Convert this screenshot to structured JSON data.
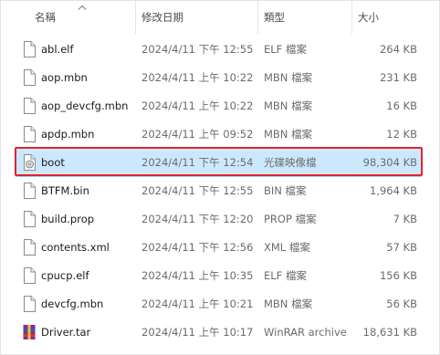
{
  "header": {
    "name": "名稱",
    "date": "修改日期",
    "type": "類型",
    "size": "大小"
  },
  "files": [
    {
      "name": "abl.elf",
      "date": "2024/4/11 下午 12:55",
      "type": "ELF 檔案",
      "size": "264 KB",
      "icon": "file-icon",
      "selected": false
    },
    {
      "name": "aop.mbn",
      "date": "2024/4/11 上午 10:22",
      "type": "MBN 檔案",
      "size": "231 KB",
      "icon": "file-icon",
      "selected": false
    },
    {
      "name": "aop_devcfg.mbn",
      "date": "2024/4/11 上午 10:22",
      "type": "MBN 檔案",
      "size": "16 KB",
      "icon": "file-icon",
      "selected": false
    },
    {
      "name": "apdp.mbn",
      "date": "2024/4/11 上午 09:52",
      "type": "MBN 檔案",
      "size": "12 KB",
      "icon": "file-icon",
      "selected": false
    },
    {
      "name": "boot",
      "date": "2024/4/11 下午 12:54",
      "type": "光碟映像檔",
      "size": "98,304 KB",
      "icon": "disc-image-icon",
      "selected": true
    },
    {
      "name": "BTFM.bin",
      "date": "2024/4/11 下午 12:55",
      "type": "BIN 檔案",
      "size": "1,964 KB",
      "icon": "file-icon",
      "selected": false
    },
    {
      "name": "build.prop",
      "date": "2024/4/11 下午 12:20",
      "type": "PROP 檔案",
      "size": "7 KB",
      "icon": "file-icon",
      "selected": false
    },
    {
      "name": "contents.xml",
      "date": "2024/4/11 下午 12:56",
      "type": "XML 檔案",
      "size": "57 KB",
      "icon": "file-icon",
      "selected": false
    },
    {
      "name": "cpucp.elf",
      "date": "2024/4/11 上午 10:35",
      "type": "ELF 檔案",
      "size": "156 KB",
      "icon": "file-icon",
      "selected": false
    },
    {
      "name": "devcfg.mbn",
      "date": "2024/4/11 上午 10:21",
      "type": "MBN 檔案",
      "size": "56 KB",
      "icon": "file-icon",
      "selected": false
    },
    {
      "name": "Driver.tar",
      "date": "2024/4/11 上午 10:17",
      "type": "WinRAR archive",
      "size": "18,631 KB",
      "icon": "winrar-archive-icon",
      "selected": false
    }
  ],
  "colors": {
    "selection_bg": "#cce8ff",
    "selection_border": "#99d1ff",
    "highlight": "#e0242b"
  }
}
